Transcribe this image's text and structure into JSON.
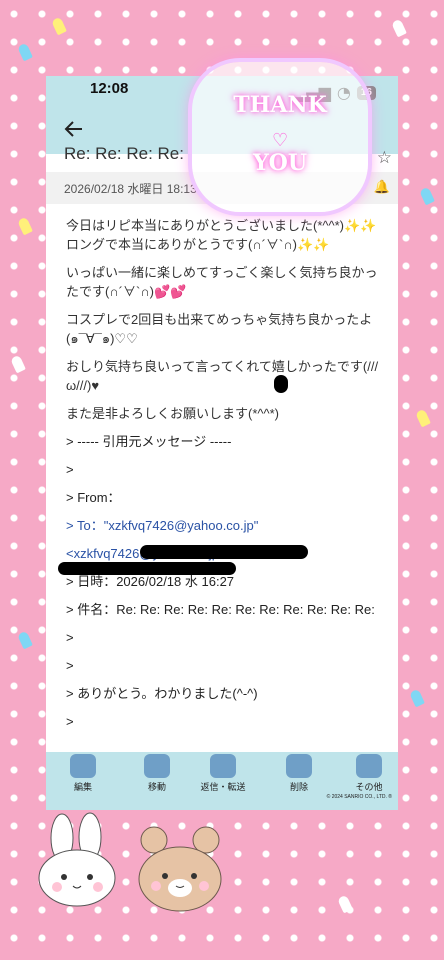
{
  "status": {
    "time": "12:08",
    "battery": "16"
  },
  "email": {
    "subject": "Re: Re: Re: Re:",
    "date": "2026/02/18 水曜日 18:13",
    "paragraphs": [
      "今日はリピ本当にありがとうございました(*^^*)✨✨ロングで本当にありがとうです(∩´∀`∩)✨✨",
      "いっぱい一緒に楽しめてすっごく楽しく気持ち良かったです(∩´∀`∩)💕💕",
      "コスプレで2回目も出来てめっちゃ気持ち良かったよ(๑¯∀¯๑)♡♡",
      "おしり気持ち良いって言ってくれて嬉しかったです(///ω///)♥",
      "また是非よろしくお願いします(*^^*)"
    ],
    "quote": [
      "> ----- 引用元メッセージ -----",
      ">",
      "> From：",
      "> To：\"xzkfvq7426@yahoo.co.jp\"",
      "<xzkfvq7426@yahoo.co.jp>",
      "> 日時：2026/02/18 水 16:27",
      "> 件名：Re: Re: Re: Re: Re: Re: Re: Re: Re: Re: Re:",
      ">",
      ">",
      "> ありがとう。わかりました(^-^)",
      ">"
    ],
    "to_email": "xzkfvq7426@yahoo.co.jp"
  },
  "toolbar": {
    "edit": "編集",
    "move": "移動",
    "reply": "返信・転送",
    "delete": "削除",
    "other": "その他",
    "copyright": "© 2024 SANRIO CO., LTD. ®"
  },
  "decor": {
    "thank": "THANK",
    "you": "YOU"
  },
  "icons": {
    "back": "back-arrow-icon",
    "star": "star-icon",
    "bell": "bell-icon"
  }
}
